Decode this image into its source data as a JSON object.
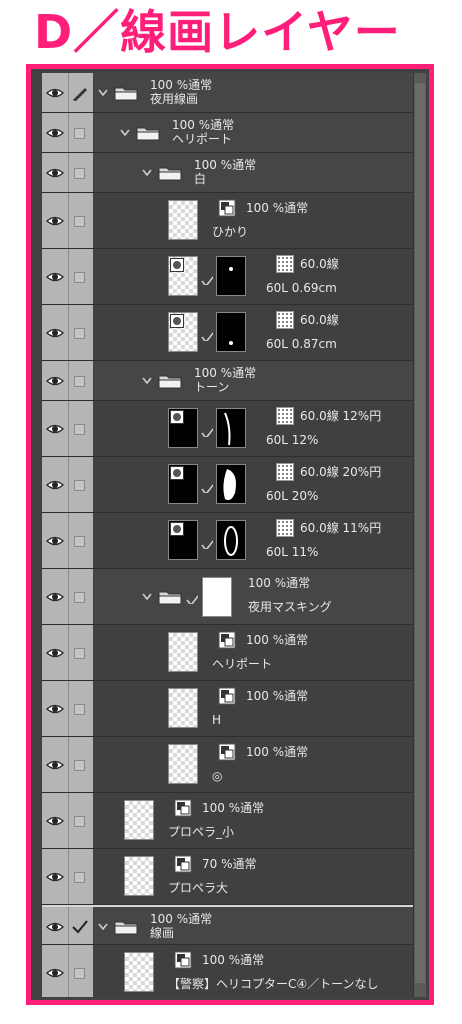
{
  "heading": "D／線画レイヤー",
  "colors": {
    "accent": "#ff1f7a",
    "panel_bg": "#424242",
    "selected": "#6f7d8f"
  },
  "icons": {
    "visibility": "eye-icon",
    "lock": "lock-checkbox",
    "pen": "pen-icon",
    "folder": "folder-icon",
    "expand": "chevron-down-icon"
  },
  "layers": [
    {
      "line1": "100 %通常",
      "line2": "夜用線画"
    },
    {
      "line1": "100 %通常",
      "line2": "ヘリポート"
    },
    {
      "line1": "100 %通常",
      "line2": "白"
    },
    {
      "line1": "100 %通常",
      "line2": "ひかり"
    },
    {
      "line1": "60.0線",
      "line2": "60L 0.69cm"
    },
    {
      "line1": "60.0線",
      "line2": "60L 0.87cm"
    },
    {
      "line1": "100 %通常",
      "line2": "トーン"
    },
    {
      "line1": "60.0線 12%円",
      "line2": "60L 12%"
    },
    {
      "line1": "60.0線 20%円",
      "line2": "60L 20%"
    },
    {
      "line1": "60.0線 11%円",
      "line2": "60L 11%"
    },
    {
      "line1": "100 %通常",
      "line2": "夜用マスキング"
    },
    {
      "line1": "100 %通常",
      "line2": "ヘリポート"
    },
    {
      "line1": "100 %通常",
      "line2": "H"
    },
    {
      "line1": "100 %通常",
      "line2": "◎"
    },
    {
      "line1": "100 %通常",
      "line2": "プロペラ_小"
    },
    {
      "line1": "70 %通常",
      "line2": "プロペラ大"
    },
    {
      "line1": "100 %通常",
      "line2": "線画"
    },
    {
      "line1": "100 %通常",
      "line2": "【警察】ヘリコプターC④／トーンなし"
    }
  ]
}
